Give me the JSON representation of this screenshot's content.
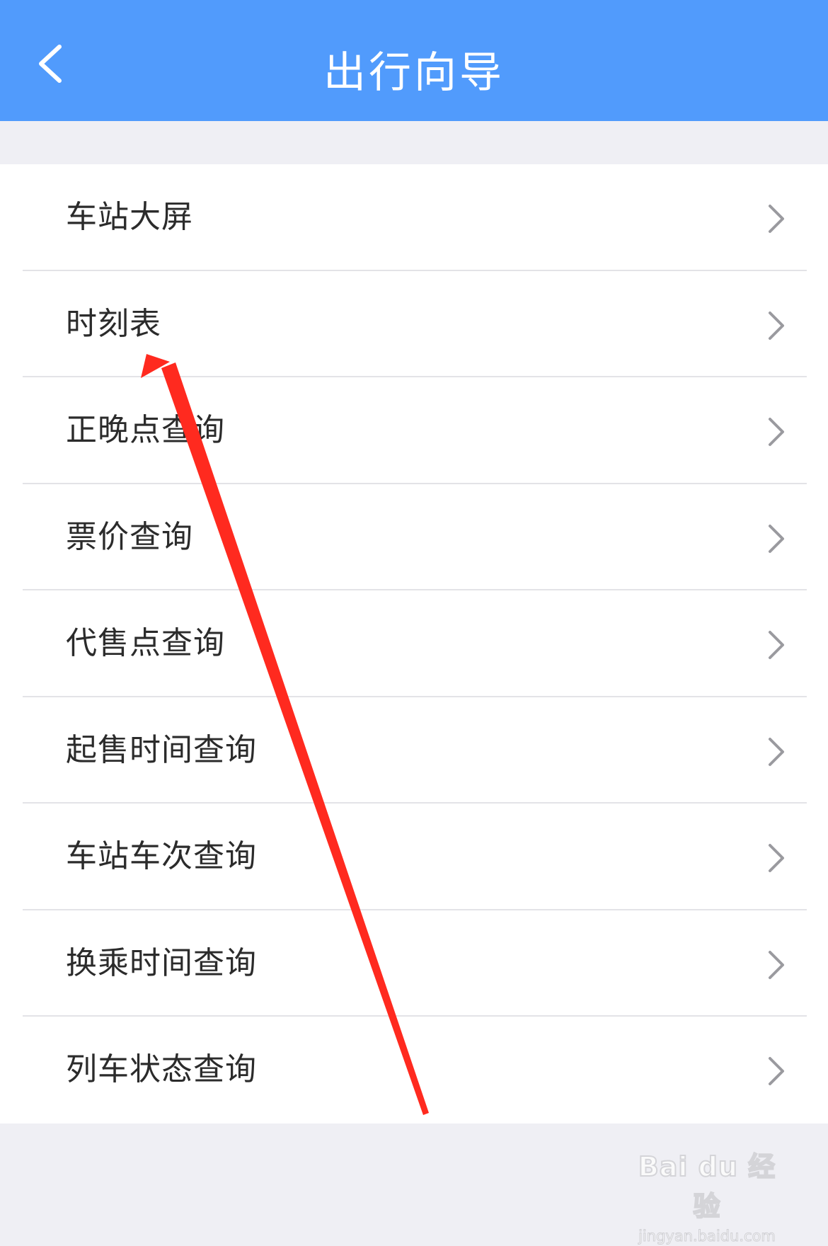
{
  "header": {
    "title": "出行向导",
    "back_icon": "chevron-left-icon"
  },
  "menu": {
    "items": [
      {
        "label": "车站大屏"
      },
      {
        "label": "时刻表"
      },
      {
        "label": "正晚点查询"
      },
      {
        "label": "票价查询"
      },
      {
        "label": "代售点查询"
      },
      {
        "label": "起售时间查询"
      },
      {
        "label": "车站车次查询"
      },
      {
        "label": "换乘时间查询"
      },
      {
        "label": "列车状态查询"
      }
    ],
    "item_icon": "chevron-right-icon"
  },
  "annotation": {
    "arrow_color": "#ff2a1f",
    "points_to": "时刻表"
  },
  "watermark": {
    "logo": "Bai du 经验",
    "url": "jingyan.baidu.com"
  },
  "colors": {
    "navbar": "#519bfc",
    "background": "#efeff4",
    "list_background": "#ffffff",
    "text": "#2b2b2b",
    "divider": "#e3e3e7",
    "chevron": "#9a9a9f"
  }
}
